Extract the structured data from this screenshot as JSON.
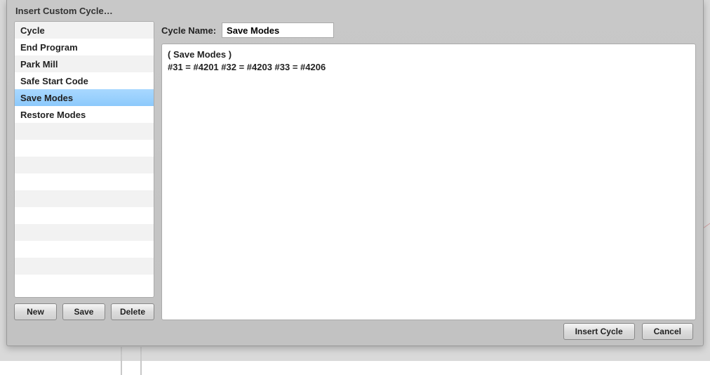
{
  "window": {
    "title": "Insert Custom Cycle…"
  },
  "sidebar": {
    "items": [
      {
        "label": "Cycle"
      },
      {
        "label": "End Program"
      },
      {
        "label": "Park Mill"
      },
      {
        "label": "Safe Start Code"
      },
      {
        "label": "Save Modes",
        "selected": true
      },
      {
        "label": "Restore Modes"
      }
    ],
    "empty_rows": 10,
    "buttons": {
      "new": "New",
      "save": "Save",
      "delete": "Delete"
    }
  },
  "main": {
    "name_label": "Cycle Name:",
    "name_value": "Save Modes",
    "code": "( Save Modes )\n#31 = #4201 #32 = #4203 #33 = #4206"
  },
  "actions": {
    "insert": "Insert Cycle",
    "cancel": "Cancel"
  }
}
